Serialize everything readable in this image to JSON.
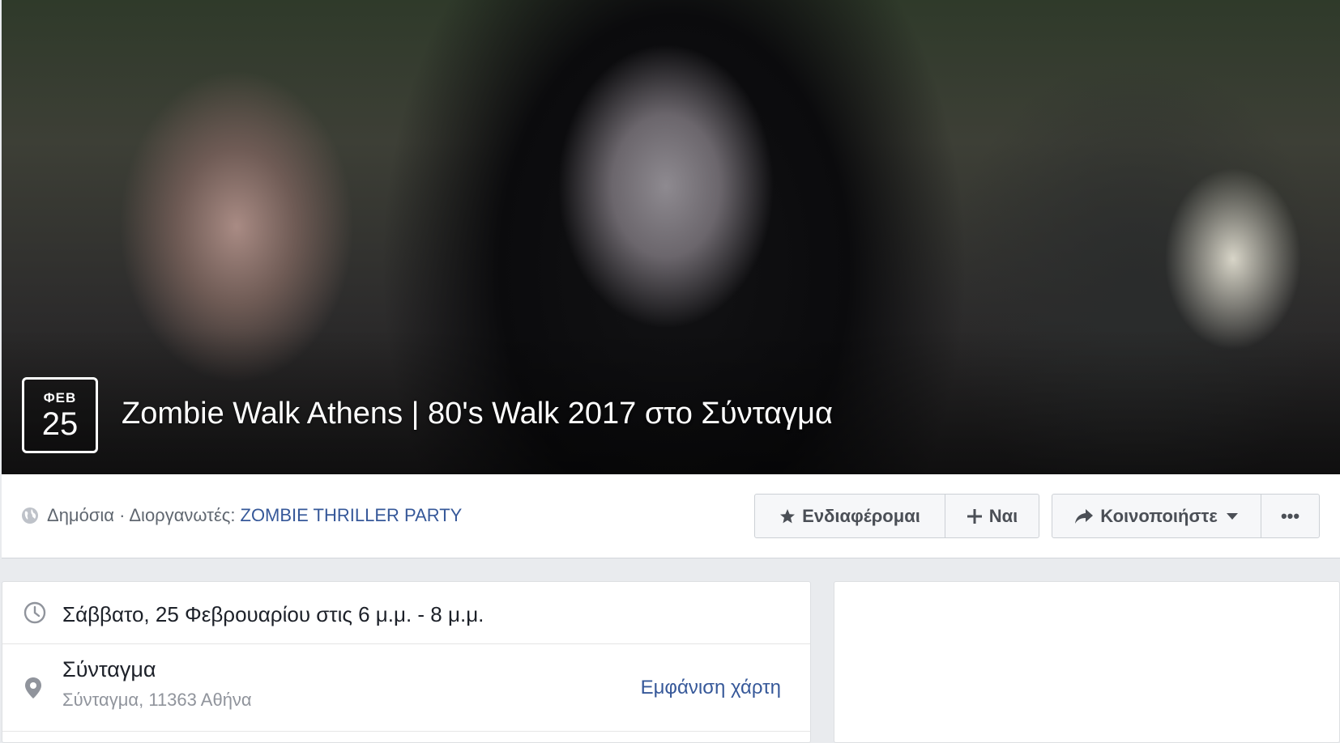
{
  "event": {
    "month": "ΦΕΒ",
    "day": "25",
    "title": "Zombie Walk Athens | 80's Walk 2017 στο Σύνταγμα"
  },
  "header": {
    "privacy_label": "Δημόσια · Διοργανωτές:",
    "organizer": "ZOMBIE THRILLER PARTY"
  },
  "actions": {
    "interested": "Ενδιαφέρομαι",
    "going": "Ναι",
    "share": "Κοινοποιήστε",
    "more": "•••"
  },
  "details": {
    "time": "Σάββατο, 25 Φεβρουαρίου στις 6 μ.μ. - 8 μ.μ.",
    "place_name": "Σύνταγμα",
    "place_address": "Σύνταγμα, 11363 Αθήνα",
    "map_link": "Εμφάνιση χάρτη"
  },
  "icons": {
    "privacy": "globe-icon",
    "interested": "star-icon",
    "going": "plus-icon",
    "share": "share-arrow-icon",
    "share_menu": "caret-down-icon",
    "time": "clock-icon",
    "place": "location-pin-icon"
  },
  "colors": {
    "link": "#365899",
    "page_bg": "#e9ebee",
    "text": "#1d2129",
    "muted": "#90949c"
  }
}
